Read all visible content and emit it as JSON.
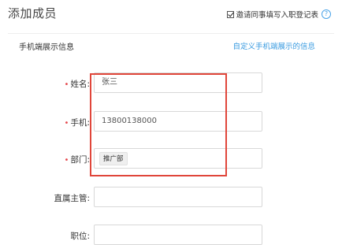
{
  "header": {
    "title": "添加成员",
    "invite_checkbox_label": "邀请同事填写入职登记表",
    "invite_checked": true,
    "help_icon": "question-circle-icon"
  },
  "section": {
    "title": "手机端展示信息",
    "link": "自定义手机端展示的信息"
  },
  "form": {
    "name": {
      "label": "姓名:",
      "required": true,
      "value": "张三"
    },
    "phone": {
      "label": "手机:",
      "required": true,
      "value": "13800138000"
    },
    "department": {
      "label": "部门:",
      "required": true,
      "tag": "推广部"
    },
    "supervisor": {
      "label": "直属主管:",
      "required": false,
      "value": ""
    },
    "position": {
      "label": "职位:",
      "required": false,
      "value": ""
    }
  },
  "colors": {
    "accent": "#3a9be0",
    "required": "#e5484d",
    "highlight": "#e0463a"
  }
}
